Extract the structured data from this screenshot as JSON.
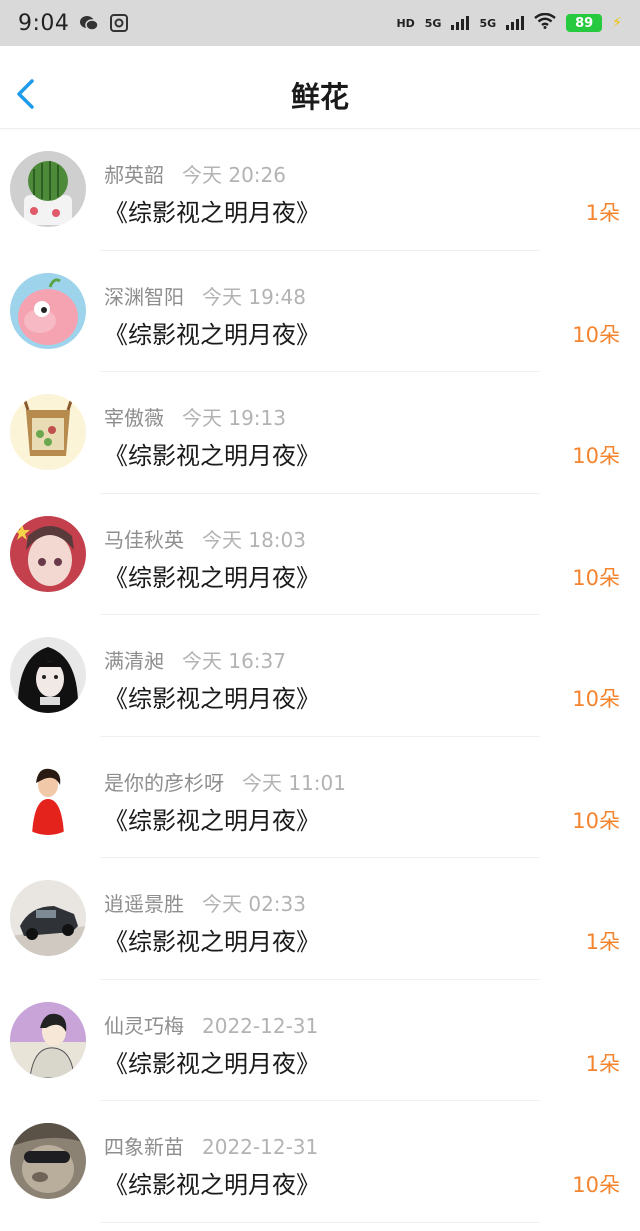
{
  "status_bar": {
    "time": "9:04",
    "network_hd": "HD",
    "network_1": "5G",
    "network_2": "5G",
    "battery": "89"
  },
  "header": {
    "title": "鲜花",
    "back_icon": "chevron-left-icon"
  },
  "colors": {
    "accent": "#1e9be9",
    "count": "#f5842f",
    "name": "#8e8e8e",
    "time": "#b3b3b3"
  },
  "rows": [
    {
      "name": "郝英韶",
      "time": "今天 20:26",
      "book": "《综影视之明月夜》",
      "count": "1朵"
    },
    {
      "name": "深渊智阳",
      "time": "今天 19:48",
      "book": "《综影视之明月夜》",
      "count": "10朵"
    },
    {
      "name": "宰傲薇",
      "time": "今天 19:13",
      "book": "《综影视之明月夜》",
      "count": "10朵"
    },
    {
      "name": "马佳秋英",
      "time": "今天 18:03",
      "book": "《综影视之明月夜》",
      "count": "10朵"
    },
    {
      "name": "满清昶",
      "time": "今天 16:37",
      "book": "《综影视之明月夜》",
      "count": "10朵"
    },
    {
      "name": "是你的彦杉呀",
      "time": "今天 11:01",
      "book": "《综影视之明月夜》",
      "count": "10朵"
    },
    {
      "name": "逍遥景胜",
      "time": "今天 02:33",
      "book": "《综影视之明月夜》",
      "count": "1朵"
    },
    {
      "name": "仙灵巧梅",
      "time": "2022-12-31",
      "book": "《综影视之明月夜》",
      "count": "1朵"
    },
    {
      "name": "四象新苗",
      "time": "2022-12-31",
      "book": "《综影视之明月夜》",
      "count": "10朵"
    }
  ]
}
